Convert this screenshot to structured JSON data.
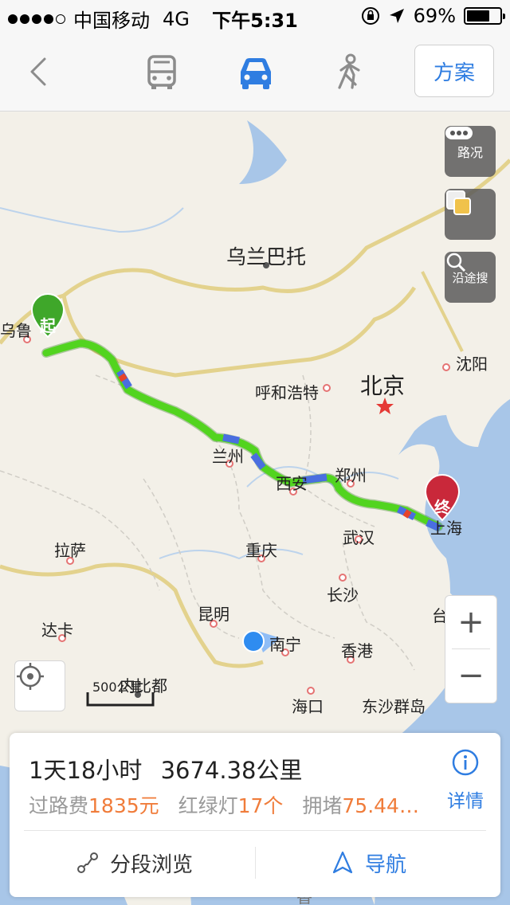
{
  "status_bar": {
    "carrier": "中国移动",
    "network": "4G",
    "time": "下午5:31",
    "battery_percent": "69%",
    "battery_level": 0.69
  },
  "nav": {
    "plan_label": "方案",
    "active_mode": "car",
    "icons": {
      "back": "chevron-left-icon",
      "bus": "bus-icon",
      "car": "car-icon",
      "walk": "walk-icon"
    },
    "colors": {
      "active": "#2f7de1",
      "inactive": "#8c8c8c"
    }
  },
  "map": {
    "cities": {
      "wulanbatuo": "乌兰巴托",
      "wulumuqi": "乌鲁",
      "huhehaote": "呼和浩特",
      "beijing": "北京",
      "shenyang": "沈阳",
      "lanzhou": "兰州",
      "xian": "西安",
      "zhengzhou": "郑州",
      "shanghai": "上海",
      "lasa": "拉萨",
      "chongqing": "重庆",
      "wuhan": "武汉",
      "changsha": "长沙",
      "kunming": "昆明",
      "nanning": "南宁",
      "xianggang": "香港",
      "taibei": "台北",
      "daka": "达卡",
      "neibidu": "内比都",
      "haikou": "海口",
      "dongsha": "东沙群岛"
    },
    "start_label": "起",
    "end_label": "终",
    "controls": {
      "traffic_label": "路况",
      "layers_icon": "layers-icon",
      "search_along_label": "沿途搜"
    },
    "scale_label": "500公里",
    "zoom_in": "+",
    "zoom_out": "−",
    "route_color": "#52d41f"
  },
  "route_card": {
    "duration": "1天18小时",
    "distance": "3674.38公里",
    "toll_label": "过路费",
    "toll_value": "1835元",
    "lights_label": "红绿灯",
    "lights_value": "17个",
    "jam_label": "拥堵",
    "jam_value": "75.44…",
    "detail_label": "详情",
    "segment_label": "分段浏览",
    "navigate_label": "导航"
  },
  "bottom_peek": "香"
}
